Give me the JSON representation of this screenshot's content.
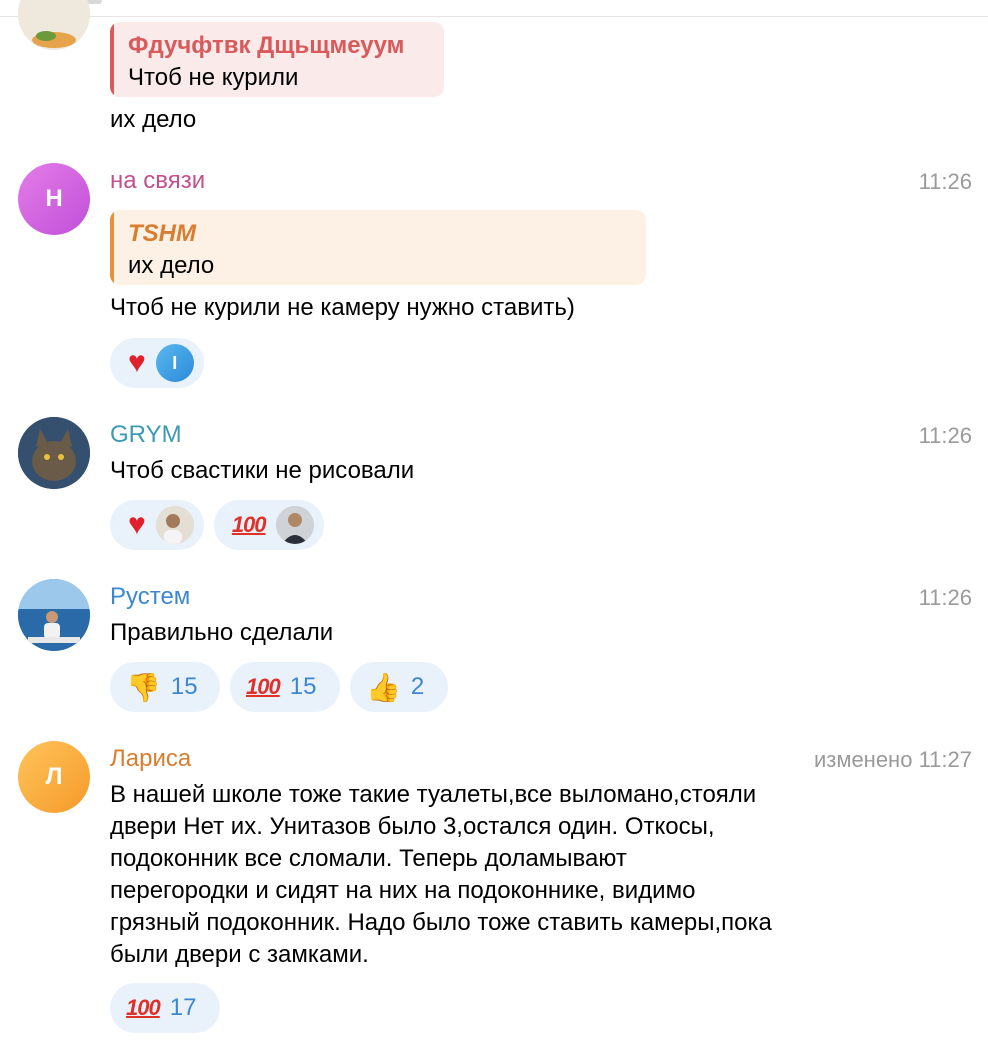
{
  "messages": [
    {
      "reply_name": "Фдучфтвк Дщьщмеуум",
      "reply_text": "Чтоб не курили",
      "text": "их дело"
    },
    {
      "avatar_letter": "Н",
      "name": "на связи",
      "time": "11:26",
      "reply_name": "TSHM",
      "reply_text": "их дело",
      "text": "Чтоб не курили не камеру нужно ставить)",
      "reactions": [
        {
          "emoji": "heart",
          "avatar_letter": "I"
        }
      ]
    },
    {
      "name": "GRYM",
      "time": "11:26",
      "text": "Чтоб свастики не рисовали",
      "reactions": [
        {
          "emoji": "heart"
        },
        {
          "emoji": "100"
        }
      ]
    },
    {
      "name": "Рустем",
      "time": "11:26",
      "text": "Правильно сделали",
      "reactions": [
        {
          "emoji": "thumbs-down",
          "count": "15"
        },
        {
          "emoji": "100",
          "count": "15"
        },
        {
          "emoji": "thumbs-up",
          "count": "2"
        }
      ]
    },
    {
      "avatar_letter": "Л",
      "name": "Лариса",
      "edited_label": "изменено",
      "time": "11:27",
      "text_lines": [
        "В нашей школе тоже такие туалеты,все выломано,стояли",
        "двери Нет их. Унитазов было 3,остался один. Откосы,",
        "подоконник все сломали. Теперь доламывают",
        "перегородки и сидят на них на подоконнике, видимо",
        "грязный подоконник. Надо было тоже ставить камеры,пока",
        "были двери с замками."
      ],
      "reactions": [
        {
          "emoji": "100",
          "count": "17"
        }
      ]
    }
  ],
  "colors": {
    "name_pink": "#c0508f",
    "name_teal": "#3a9bb3",
    "name_blue": "#3c87d0",
    "name_orange": "#d97d2e",
    "reply_red": "#d85a5a",
    "reply_orange": "#e5913e",
    "reaction_bg": "#e9f2fb",
    "time_gray": "#9a9a9a"
  }
}
